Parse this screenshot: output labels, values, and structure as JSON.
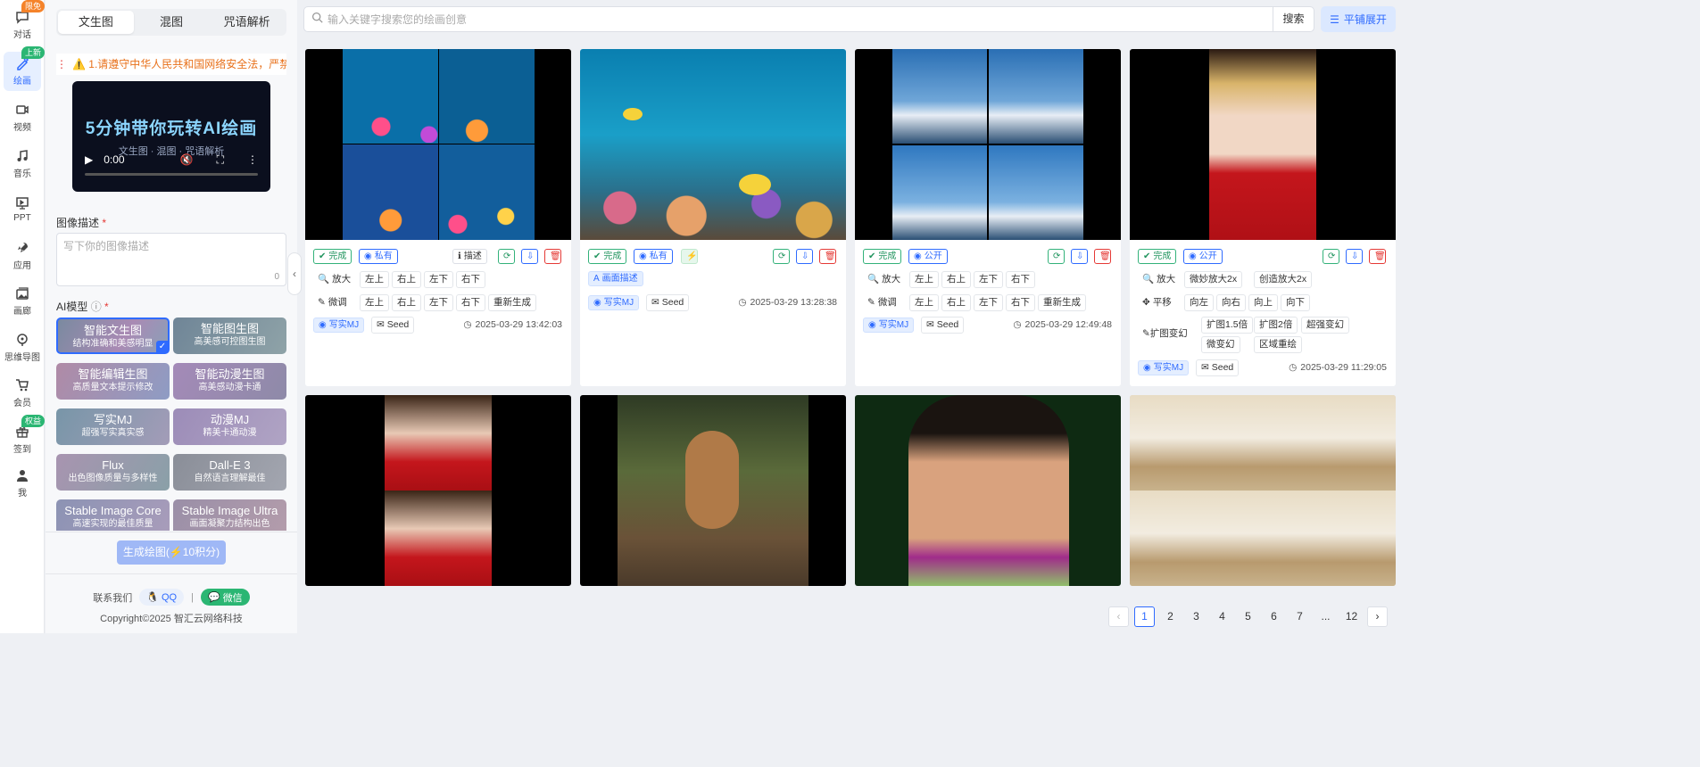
{
  "nav": [
    {
      "label": "对话",
      "icon": "chat-icon",
      "badge": "限免",
      "badge_color": "#f5832a"
    },
    {
      "label": "绘画",
      "icon": "paint-icon",
      "badge": "上新",
      "badge_color": "#2bb673",
      "active": true
    },
    {
      "label": "视频",
      "icon": "video-icon"
    },
    {
      "label": "音乐",
      "icon": "music-icon"
    },
    {
      "label": "PPT",
      "icon": "ppt-icon"
    },
    {
      "label": "应用",
      "icon": "rocket-icon"
    },
    {
      "label": "画廊",
      "icon": "gallery-icon"
    },
    {
      "label": "思维导图",
      "icon": "mindmap-icon"
    },
    {
      "label": "会员",
      "icon": "cart-icon"
    },
    {
      "label": "签到",
      "icon": "gift-icon",
      "badge": "权益",
      "badge_color": "#2bb673"
    },
    {
      "label": "我",
      "icon": "user-icon"
    }
  ],
  "panel": {
    "tabs": [
      "文生图",
      "混图",
      "咒语解析"
    ],
    "active_tab": 0,
    "notice": "⚠️ 1.请遵守中华人民共和国网络安全法，严禁",
    "video": {
      "title": "5分钟带你玩转AI绘画",
      "subtitle": "文生图 · 混图 · 咒语解析",
      "time": "0:00"
    },
    "desc_label": "图像描述",
    "desc_placeholder": "写下你的图像描述",
    "desc_count": "0",
    "model_label": "AI模型",
    "models": [
      {
        "name": "智能文生图",
        "sub": "结构准确和美感明显",
        "selected": true
      },
      {
        "name": "智能图生图",
        "sub": "高美感可控图生图"
      },
      {
        "name": "智能编辑生图",
        "sub": "高质量文本提示修改"
      },
      {
        "name": "智能动漫生图",
        "sub": "高美感动漫卡通"
      },
      {
        "name": "写实MJ",
        "sub": "超强写实真实感"
      },
      {
        "name": "动漫MJ",
        "sub": "精美卡通动漫"
      },
      {
        "name": "Flux",
        "sub": "出色图像质量与多样性"
      },
      {
        "name": "Dall-E 3",
        "sub": "自然语言理解最佳"
      },
      {
        "name": "Stable Image Core",
        "sub": "高速实现的最佳质量"
      },
      {
        "name": "Stable Image Ultra",
        "sub": "画面凝聚力结构出色"
      }
    ],
    "generate": "生成绘图(⚡10积分)",
    "contact": "联系我们",
    "qq": "QQ",
    "wechat": "微信",
    "copyright": "Copyright©2025 智汇云网络科技"
  },
  "topbar": {
    "search_placeholder": "输入关键字搜索您的绘画创意",
    "search_btn": "搜索",
    "layout_btn": "平铺展开"
  },
  "cards": [
    {
      "status": "完成",
      "privacy": "私有",
      "describe": "描述",
      "rows": [
        [
          "放大",
          "左上",
          "右上",
          "左下",
          "右下"
        ],
        [
          "微调",
          "左上",
          "右上",
          "左下",
          "右下",
          "重新生成"
        ]
      ],
      "model": "写实MJ",
      "seed": "Seed",
      "time": "2025-03-29 13:42:03"
    },
    {
      "status": "完成",
      "privacy": "私有",
      "extra": "画面描述",
      "model": "写实MJ",
      "seed": "Seed",
      "time": "2025-03-29 13:28:38"
    },
    {
      "status": "完成",
      "privacy": "公开",
      "rows": [
        [
          "放大",
          "左上",
          "右上",
          "左下",
          "右下"
        ],
        [
          "微调",
          "左上",
          "右上",
          "左下",
          "右下",
          "重新生成"
        ]
      ],
      "model": "写实MJ",
      "seed": "Seed",
      "time": "2025-03-29 12:49:48"
    },
    {
      "status": "完成",
      "privacy": "公开",
      "rows": [
        [
          "放大",
          "微妙放大2x",
          "创造放大2x"
        ],
        [
          "平移",
          "向左",
          "向右",
          "向上",
          "向下"
        ]
      ],
      "expand": "扩图变幻",
      "expand_opts": [
        "扩图1.5倍",
        "扩图2倍",
        "超强变幻",
        "微变幻",
        "区域重绘"
      ],
      "model": "写实MJ",
      "seed": "Seed",
      "time": "2025-03-29 11:29:05"
    }
  ],
  "pagination": {
    "pages": [
      "1",
      "2",
      "3",
      "4",
      "5",
      "6",
      "7",
      "...",
      "12"
    ],
    "current": "1"
  },
  "colors": {
    "accent": "#2f6bff",
    "success": "#22955f",
    "danger": "#e53935",
    "warning": "#e8711b"
  }
}
